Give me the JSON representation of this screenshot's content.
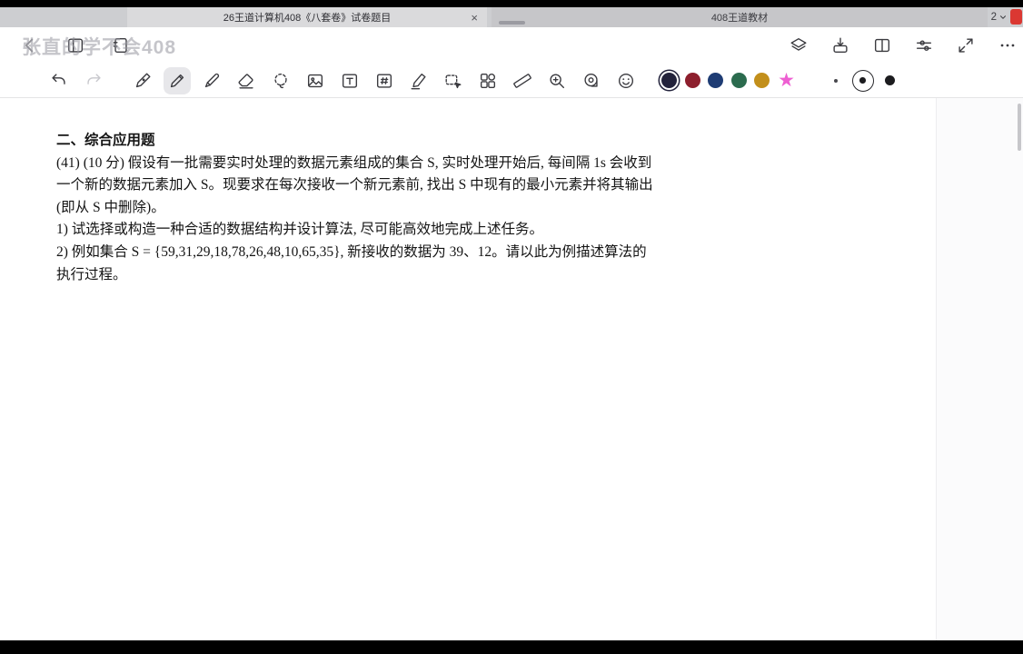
{
  "tab_bar": {
    "active_tab_title": "26王道计算机408《八套卷》试卷题目",
    "close_label": "×",
    "inactive_tab_title": "408王道教材",
    "tab_count": "2"
  },
  "watermark": "张直的学不会408",
  "nav_toolbar": {
    "left_icons": [
      "back-chevron-icon",
      "page-thumbnails-icon",
      "notebook-icon"
    ],
    "right_icons": [
      "layers-icon",
      "export-icon",
      "book-pages-icon",
      "sliders-icon",
      "fullscreen-icon",
      "more-icon"
    ]
  },
  "pen_toolbar": {
    "tools": [
      "undo-icon",
      "redo-icon",
      "fountain-pen-icon",
      "pencil-icon",
      "ballpoint-pen-icon",
      "eraser-icon",
      "lasso-icon",
      "image-icon",
      "text-box-icon",
      "hashtag-icon",
      "highlighter-icon",
      "selection-icon",
      "elements-icon",
      "ruler-icon",
      "magnifier-icon",
      "tape-icon",
      "sticker-icon"
    ],
    "selected_tool": "pencil-icon",
    "colors": [
      "#23233c",
      "#8d1f2d",
      "#1e3c74",
      "#2b6b4e",
      "#c28f1b",
      "#ee5fd2"
    ],
    "color_shapes": [
      "circle",
      "circle",
      "circle",
      "circle",
      "circle",
      "star"
    ],
    "selected_color_index": 0,
    "stroke_sizes": [
      "small",
      "medium",
      "large"
    ],
    "selected_stroke": "medium"
  },
  "document": {
    "heading": "二、综合应用题",
    "lines": [
      "(41) (10 分) 假设有一批需要实时处理的数据元素组成的集合 S, 实时处理开始后, 每间隔 1s 会收到",
      "一个新的数据元素加入 S。现要求在每次接收一个新元素前, 找出 S 中现有的最小元素并将其输出",
      "(即从 S 中删除)。",
      "1) 试选择或构造一种合适的数据结构并设计算法, 尽可能高效地完成上述任务。",
      "2) 例如集合 S = {59,31,29,18,78,26,48,10,65,35}, 新接收的数据为 39、12。请以此为例描述算法的",
      "执行过程。"
    ]
  }
}
